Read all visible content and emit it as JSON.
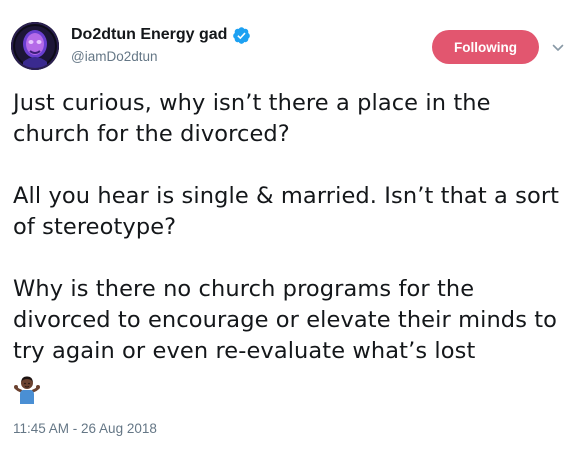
{
  "author": {
    "display_name": "Do2dtun Energy gad",
    "handle": "@iamDo2dtun",
    "verified": true
  },
  "follow_button": {
    "label": "Following"
  },
  "tweet": {
    "paragraphs": [
      "Just curious, why isn’t there a place in the church for the divorced?",
      "All you hear is single & married. Isn’t that a sort of stereotype?",
      "Why is there no church programs for the divorced to encourage or elevate their minds to try again or even re-evaluate what’s lost"
    ],
    "emoji": "man-shrugging-emoji",
    "timestamp": "11:45 AM - 26 Aug 2018"
  },
  "colors": {
    "follow_button_bg": "#e2566f",
    "verified_badge": "#1da1f2",
    "secondary_text": "#657786",
    "primary_text": "#14171a"
  }
}
